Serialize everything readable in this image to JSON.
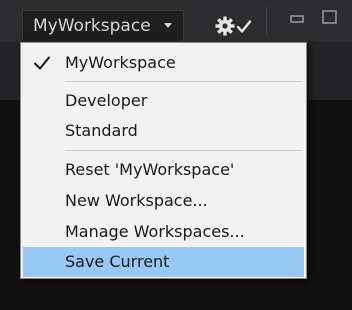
{
  "toolbar": {
    "workspace_selector": {
      "value": "MyWorkspace",
      "icon": "chevron-down-icon"
    },
    "settings_icon": "gear-check-icon",
    "window_controls": [
      {
        "name": "minimize",
        "icon": "minimize-icon"
      },
      {
        "name": "maximize",
        "icon": "maximize-icon"
      }
    ]
  },
  "menu": {
    "items": [
      {
        "label": "MyWorkspace",
        "checked": true,
        "group": 1
      },
      {
        "label": "Developer",
        "checked": false,
        "group": 2
      },
      {
        "label": "Standard",
        "checked": false,
        "group": 2
      },
      {
        "label": "Reset 'MyWorkspace'",
        "checked": false,
        "group": 3
      },
      {
        "label": "New Workspace...",
        "checked": false,
        "group": 3
      },
      {
        "label": "Manage Workspaces...",
        "checked": false,
        "group": 3
      },
      {
        "label": "Save Current",
        "checked": false,
        "group": 3,
        "highlighted": true
      }
    ]
  },
  "colors": {
    "menu_background": "#f2f2f2",
    "highlight": "#99c8f5",
    "check": "#1a1a1a",
    "toolbar": "#2d2d30"
  }
}
